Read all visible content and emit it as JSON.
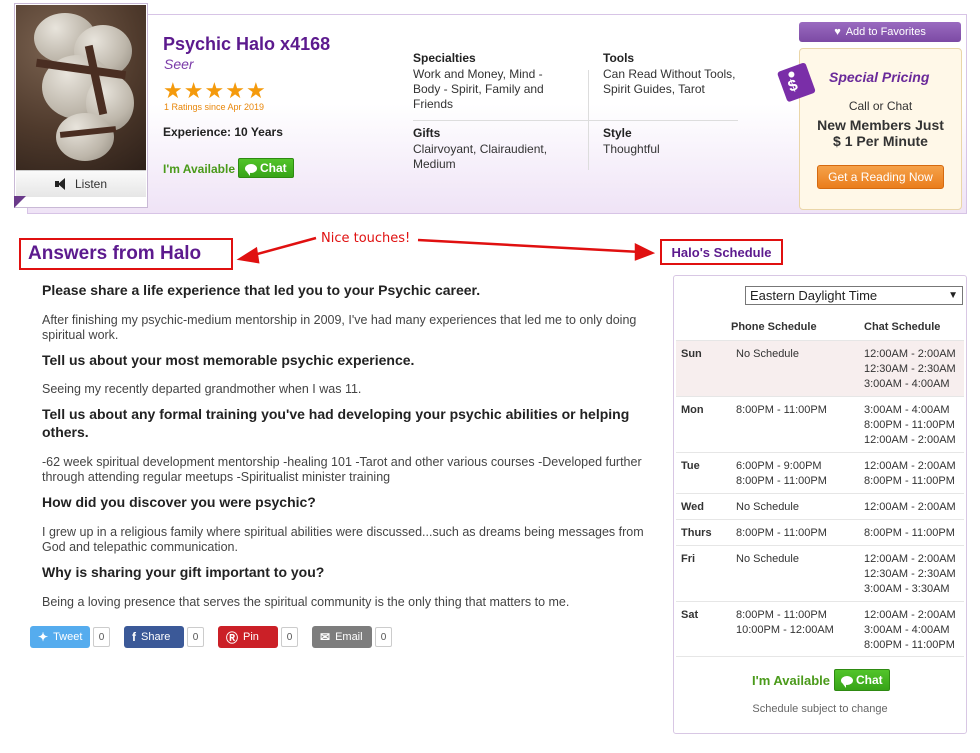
{
  "profile": {
    "name": "Psychic Halo x4168",
    "title": "Seer",
    "rating_stars": 5,
    "ratings_text": "1 Ratings since Apr 2019",
    "experience": "Experience: 10 Years",
    "available_text": "I'm Available",
    "chat_label": "Chat",
    "listen_label": "Listen"
  },
  "details": {
    "specialties_label": "Specialties",
    "specialties": "Work and Money, Mind - Body - Spirit, Family and Friends",
    "tools_label": "Tools",
    "tools": "Can Read Without Tools, Spirit Guides, Tarot",
    "gifts_label": "Gifts",
    "gifts": "Clairvoyant, Clairaudient, Medium",
    "style_label": "Style",
    "style": "Thoughtful"
  },
  "promo": {
    "favorites_label": "Add to Favorites",
    "special_title": "Special Pricing",
    "call_or_chat": "Call or Chat",
    "offer_line1": "New Members Just",
    "offer_line2": "$ 1 Per Minute",
    "cta_label": "Get a Reading Now",
    "tag_symbol": "$"
  },
  "annotation": {
    "text": "Nice touches!",
    "color": "#e01010"
  },
  "answers": {
    "title": "Answers from Halo",
    "items": [
      {
        "q": "Please share a life experience that led you to your Psychic career.",
        "a": "After finishing my psychic-medium mentorship in 2009, I've had many experiences that led me to only doing spiritual work."
      },
      {
        "q": "Tell us about your most memorable psychic experience.",
        "a": "Seeing my recently departed grandmother when I was 11."
      },
      {
        "q": "Tell us about any formal training you've had developing your psychic abilities or helping others.",
        "a": "-62 week spiritual development mentorship -healing 101 -Tarot and other various courses -Developed further through attending regular meetups -Spiritualist minister training"
      },
      {
        "q": "How did you discover you were psychic?",
        "a": "I grew up in a religious family where spiritual abilities were discussed...such as dreams being messages from God and telepathic communication."
      },
      {
        "q": "Why is sharing your gift important to you?",
        "a": "Being a loving presence that serves the spiritual community is the only thing that matters to me."
      }
    ]
  },
  "share": [
    {
      "label": "Tweet",
      "icon": "twitter-icon",
      "count": "0",
      "color": "#55acee"
    },
    {
      "label": "Share",
      "icon": "facebook-icon",
      "count": "0",
      "color": "#3b5998"
    },
    {
      "label": "Pin",
      "icon": "pinterest-icon",
      "count": "0",
      "color": "#cb2027"
    },
    {
      "label": "Email",
      "icon": "email-icon",
      "count": "0",
      "color": "#7d7d7d"
    }
  ],
  "schedule": {
    "title": "Halo's Schedule",
    "timezone": "Eastern Daylight Time",
    "phone_header": "Phone Schedule",
    "chat_header": "Chat Schedule",
    "rows": [
      {
        "day": "Sun",
        "phone": [
          "No Schedule"
        ],
        "chat": [
          "12:00AM - 2:00AM",
          "12:30AM - 2:30AM",
          "3:00AM - 4:00AM"
        ]
      },
      {
        "day": "Mon",
        "phone": [
          "8:00PM - 11:00PM"
        ],
        "chat": [
          "3:00AM - 4:00AM",
          "8:00PM - 11:00PM",
          "12:00AM - 2:00AM"
        ]
      },
      {
        "day": "Tue",
        "phone": [
          "6:00PM - 9:00PM",
          "8:00PM - 11:00PM"
        ],
        "chat": [
          "12:00AM - 2:00AM",
          "8:00PM - 11:00PM"
        ]
      },
      {
        "day": "Wed",
        "phone": [
          "No Schedule"
        ],
        "chat": [
          "12:00AM - 2:00AM"
        ]
      },
      {
        "day": "Thurs",
        "phone": [
          "8:00PM - 11:00PM"
        ],
        "chat": [
          "8:00PM - 11:00PM"
        ]
      },
      {
        "day": "Fri",
        "phone": [
          "No Schedule"
        ],
        "chat": [
          "12:00AM - 2:00AM",
          "12:30AM - 2:30AM",
          "3:00AM - 3:30AM"
        ]
      },
      {
        "day": "Sat",
        "phone": [
          "8:00PM - 11:00PM",
          "10:00PM - 12:00AM"
        ],
        "chat": [
          "12:00AM - 2:00AM",
          "3:00AM - 4:00AM",
          "8:00PM - 11:00PM"
        ]
      }
    ],
    "available_text": "I'm Available",
    "chat_label": "Chat",
    "note": "Schedule subject to change"
  }
}
